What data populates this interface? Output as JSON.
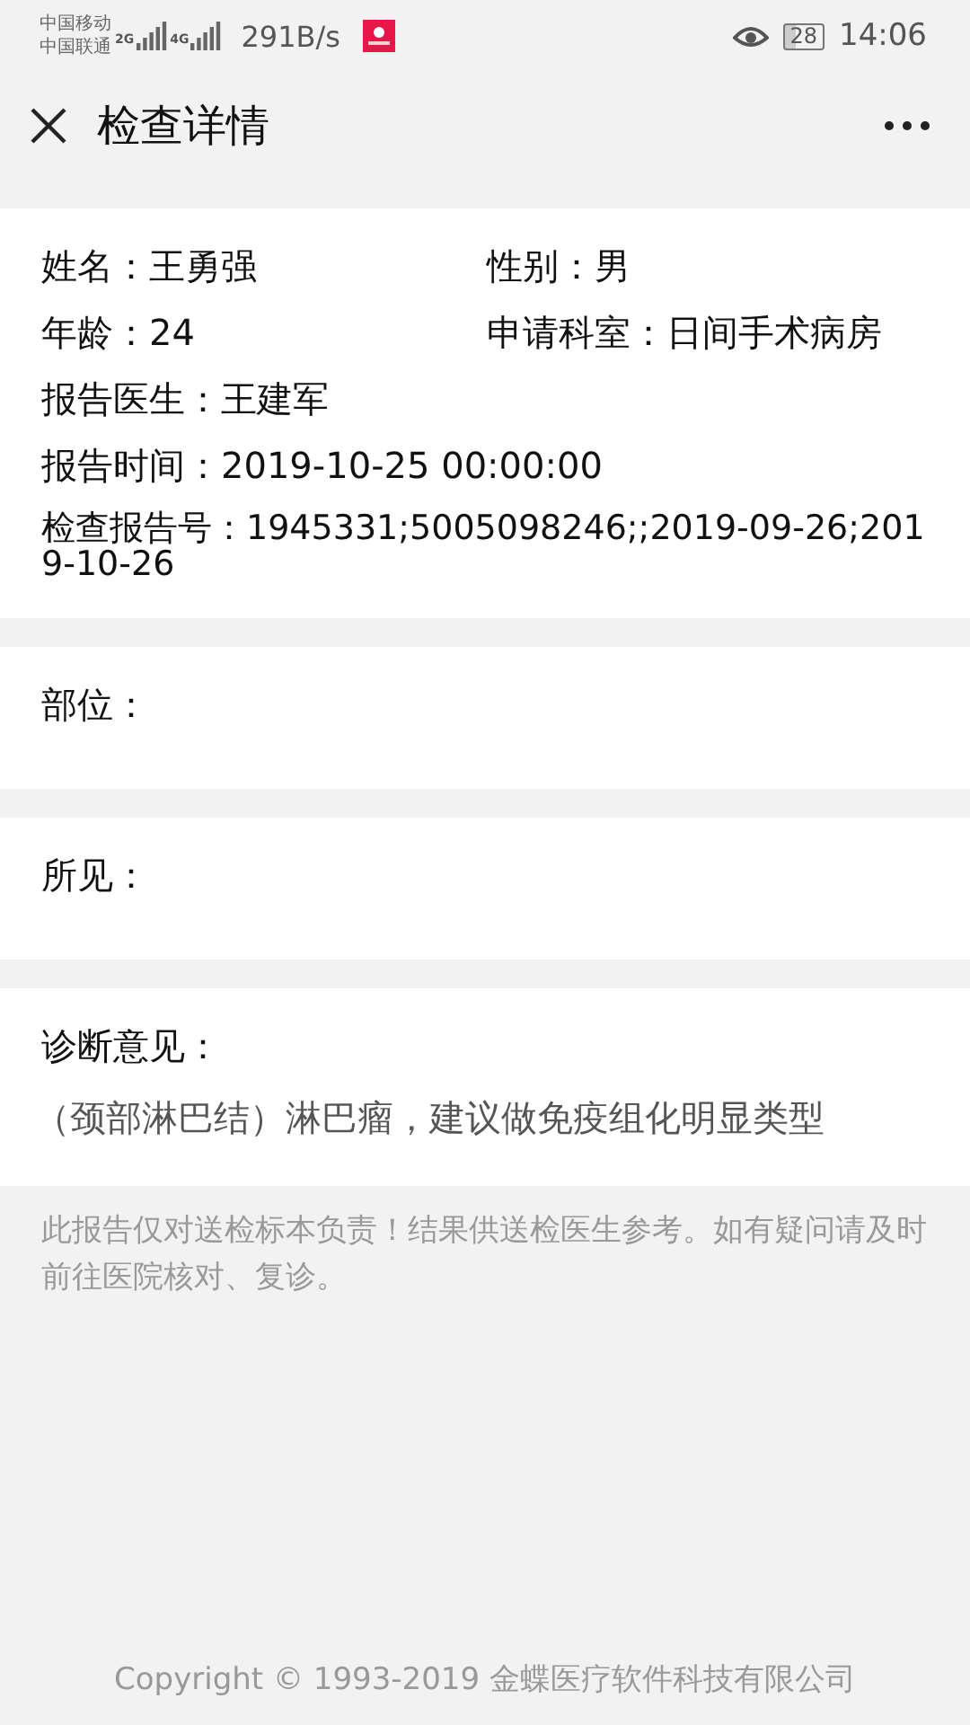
{
  "status_bar": {
    "carriers": [
      "中国移动",
      "中国联通"
    ],
    "network_types": [
      "2G",
      "4G"
    ],
    "speed": "291B/s",
    "battery": "28",
    "time": "14:06"
  },
  "header": {
    "title": "检查详情"
  },
  "info": {
    "rows": [
      {
        "fields": [
          {
            "label": "姓名：",
            "value": "王勇强"
          },
          {
            "label": "性别：",
            "value": "男"
          }
        ]
      },
      {
        "fields": [
          {
            "label": "年龄：",
            "value": "24"
          },
          {
            "label": "申请科室：",
            "value": "日间手术病房"
          }
        ]
      },
      {
        "fields": [
          {
            "label": "报告医生：",
            "value": "王建军"
          }
        ]
      },
      {
        "fields": [
          {
            "label": "报告时间：",
            "value": "2019-10-25 00:00:00"
          }
        ]
      },
      {
        "fields": [
          {
            "label": "检查报告号：",
            "value": "1945331;5005098246;;2019-09-26;2019-10-26"
          }
        ]
      }
    ]
  },
  "sections": [
    {
      "label": "部位："
    },
    {
      "label": "所见："
    },
    {
      "label": "诊断意见：",
      "content": "（颈部淋巴结）淋巴瘤，建议做免疫组化明显类型"
    }
  ],
  "notice": "此报告仅对送检标本负责！结果供送检医生参考。如有疑问请及时前往医院核对、复诊。",
  "footer": "Copyright © 1993-2019 金蝶医疗软件科技有限公司"
}
